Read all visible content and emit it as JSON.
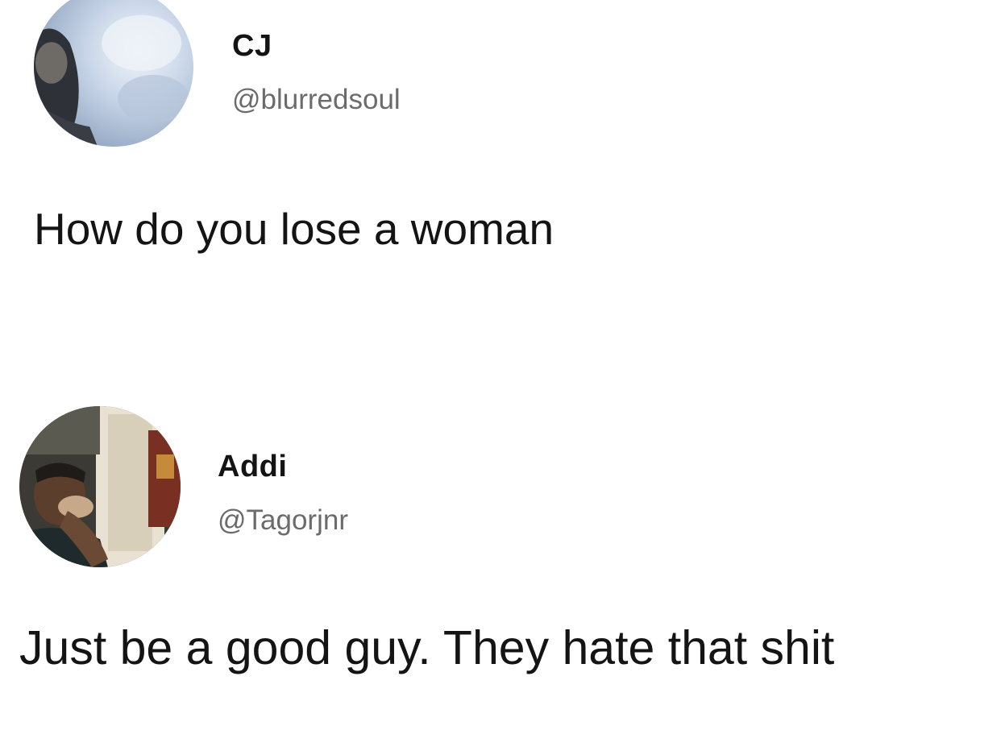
{
  "posts": [
    {
      "display_name": "CJ",
      "handle": "@blurredsoul",
      "text": "How do you lose a woman"
    },
    {
      "display_name": "Addi",
      "handle": "@Tagorjnr",
      "text": "Just be a good guy. They hate that shit"
    }
  ]
}
